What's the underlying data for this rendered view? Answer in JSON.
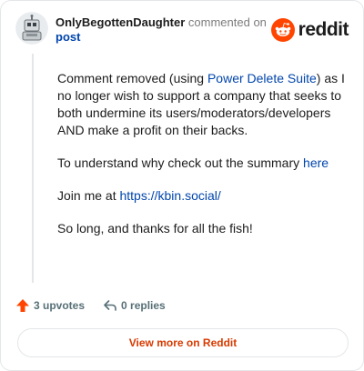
{
  "header": {
    "username": "OnlyBegottenDaughter",
    "action_text": "commented on",
    "post_link": "post",
    "logo_text": "reddit"
  },
  "comment": {
    "p1_before": "Comment removed (using ",
    "p1_link": "Power Delete Suite",
    "p1_after": ") as I no longer wish to support a company that seeks to both undermine its users/moderators/developers AND make a profit on their backs.",
    "p2_before": "To understand why check out the summary ",
    "p2_link": "here",
    "p3_before": "Join me at ",
    "p3_link": "https://kbin.social/",
    "p4": "So long, and thanks for all the fish!"
  },
  "actions": {
    "upvotes": "3 upvotes",
    "replies": "0 replies"
  },
  "footer": {
    "view_more": "View more on Reddit"
  },
  "icons": {
    "avatar": "robot-avatar-icon",
    "logo": "reddit-alien-icon",
    "upvote": "upvote-arrow-icon",
    "reply": "reply-arrow-icon"
  },
  "colors": {
    "brand": "#ff4500",
    "link": "#0045ac",
    "cta": "#d93a00",
    "muted": "#576f76"
  }
}
